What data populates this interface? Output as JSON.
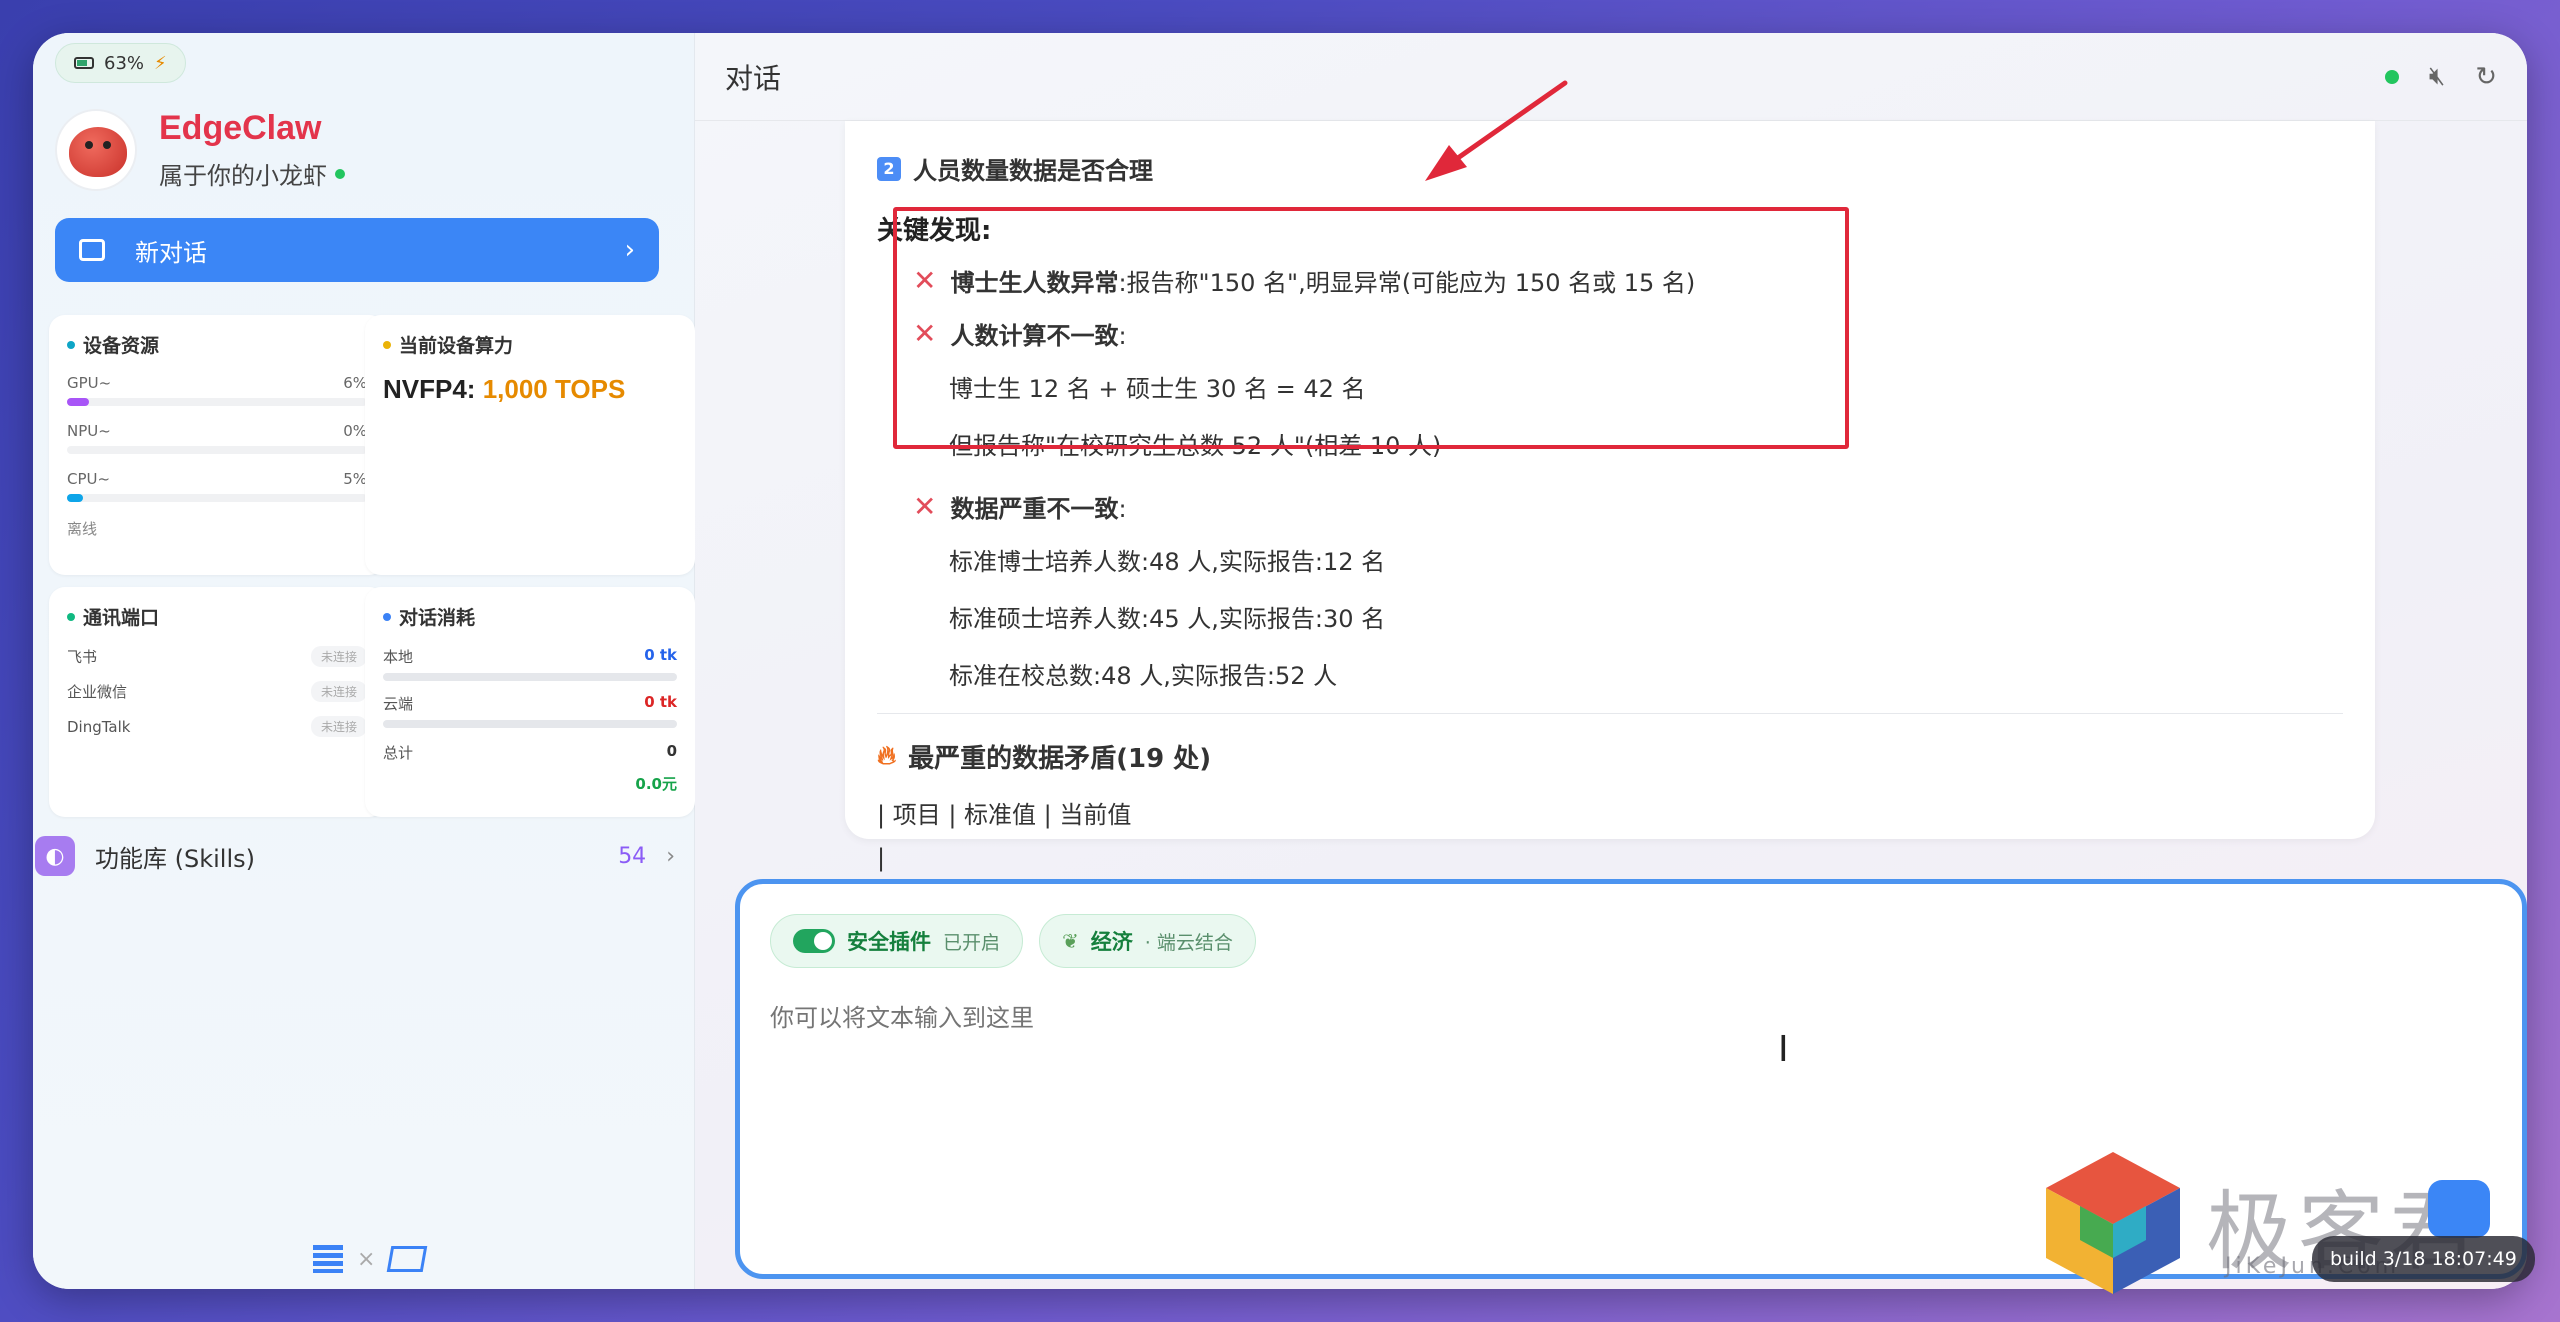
{
  "sidebar": {
    "battery": "63%",
    "app_name": "EdgeClaw",
    "app_sub": "属于你的小龙虾",
    "new_chat": "新对话",
    "device": {
      "title": "设备资源",
      "rows": [
        {
          "label": "GPU~",
          "value": "6%"
        },
        {
          "label": "NPU~",
          "value": "0%"
        },
        {
          "label": "CPU~",
          "value": "5%"
        }
      ],
      "status": "离线"
    },
    "compute": {
      "title": "当前设备算力",
      "label": "NVFP4:",
      "value": "1,000 TOPS"
    },
    "ports": {
      "title": "通讯端口",
      "items": [
        {
          "label": "飞书",
          "status": "未连接"
        },
        {
          "label": "企业微信",
          "status": "未连接"
        },
        {
          "label": "DingTalk",
          "status": "未连接"
        }
      ]
    },
    "tokens": {
      "title": "对话消耗",
      "local_label": "本地",
      "local_value": "0 tk",
      "cloud_label": "云端",
      "cloud_value": "0 tk",
      "total_label": "总计",
      "total_value": "0",
      "cost": "0.0元"
    },
    "skills": {
      "label": "功能库 (Skills)",
      "count": "54"
    }
  },
  "header": {
    "title": "对话"
  },
  "message": {
    "section_num": "2",
    "section_title": "人员数量数据是否合理",
    "finding_title": "关键发现:",
    "items": [
      {
        "bold": "博士生人数异常",
        "text": ":报告称\"150 名\",明显异常(可能应为 150 名或 15 名)"
      },
      {
        "bold": "人数计算不一致",
        "text": ":"
      }
    ],
    "calc_lines": [
      "博士生 12 名 + 硕士生 30 名 = 42 名",
      "但报告称\"在校研究生总数 52 人\"(相差 10 人)"
    ],
    "item3": {
      "bold": "数据严重不一致",
      "text": ":"
    },
    "std_lines": [
      "标准博士培养人数:48 人,实际报告:12 名",
      "标准硕士培养人数:45 人,实际报告:30 名",
      "标准在校总数:48 人,实际报告:52 人"
    ],
    "hot_title": "最严重的数据矛盾(19 处)",
    "table_line": "| 项目 | 标准值 | 当前值",
    "table_line2": "|"
  },
  "input": {
    "chip1_label": "安全插件",
    "chip1_sub": "已开启",
    "chip2_label": "经济",
    "chip2_sub": "· 端云结合",
    "placeholder": "你可以将文本输入到这里"
  },
  "watermark": {
    "text": "极客君",
    "url": "JiKeJun.Com"
  },
  "build": "build 3/18 18:07:49",
  "colors": {
    "accent": "#3b86f6",
    "brand": "#e3344b",
    "highlight": "#e0283a",
    "success": "#22c55e"
  }
}
